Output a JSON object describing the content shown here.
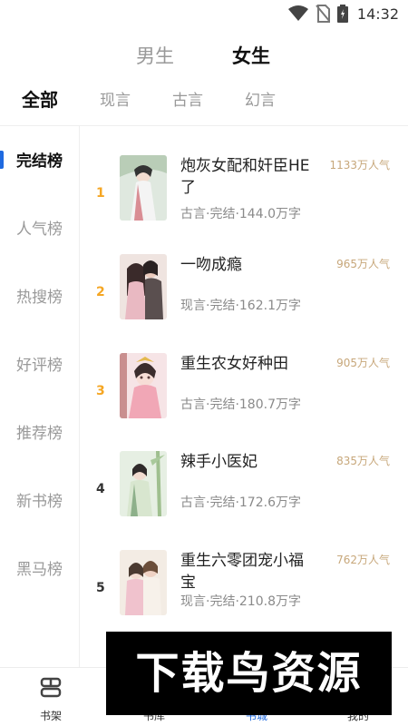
{
  "status_bar": {
    "time": "14:32",
    "icons": [
      "wifi-icon",
      "no-sim-icon",
      "battery-icon"
    ]
  },
  "gender_tabs": [
    {
      "label": "男生",
      "active": false
    },
    {
      "label": "女生",
      "active": true
    }
  ],
  "category_tabs": [
    {
      "label": "全部",
      "active": true
    },
    {
      "label": "现言",
      "active": false
    },
    {
      "label": "古言",
      "active": false
    },
    {
      "label": "幻言",
      "active": false
    }
  ],
  "sidebar": {
    "items": [
      {
        "label": "完结榜",
        "active": true
      },
      {
        "label": "人气榜",
        "active": false
      },
      {
        "label": "热搜榜",
        "active": false
      },
      {
        "label": "好评榜",
        "active": false
      },
      {
        "label": "推荐榜",
        "active": false
      },
      {
        "label": "新书榜",
        "active": false
      },
      {
        "label": "黑马榜",
        "active": false
      }
    ]
  },
  "books": [
    {
      "rank": "1",
      "title": "炮灰女配和奸臣HE了",
      "meta": "古言·完结·144.0万字",
      "heat": "1133万人气"
    },
    {
      "rank": "2",
      "title": "一吻成瘾",
      "meta": "现言·完结·162.1万字",
      "heat": "965万人气"
    },
    {
      "rank": "3",
      "title": "重生农女好种田",
      "meta": "古言·完结·180.7万字",
      "heat": "905万人气"
    },
    {
      "rank": "4",
      "title": "辣手小医妃",
      "meta": "古言·完结·172.6万字",
      "heat": "835万人气"
    },
    {
      "rank": "5",
      "title": "重生六零团宠小福宝",
      "meta": "现言·完结·210.8万字",
      "heat": "762万人气"
    }
  ],
  "bottom_nav": [
    {
      "label": "书架",
      "icon": "bookshelf-icon",
      "active": false
    },
    {
      "label": "书库",
      "icon": "library-icon",
      "active": false
    },
    {
      "label": "书城",
      "icon": "bookstore-icon",
      "active": true
    },
    {
      "label": "我的",
      "icon": "profile-icon",
      "active": false
    }
  ],
  "watermark": {
    "text": "下载鸟资源"
  },
  "colors": {
    "accent": "#1f6ae0",
    "rank_top": "#f5a623",
    "rank_normal": "#333333",
    "heat": "#c7a77a"
  }
}
